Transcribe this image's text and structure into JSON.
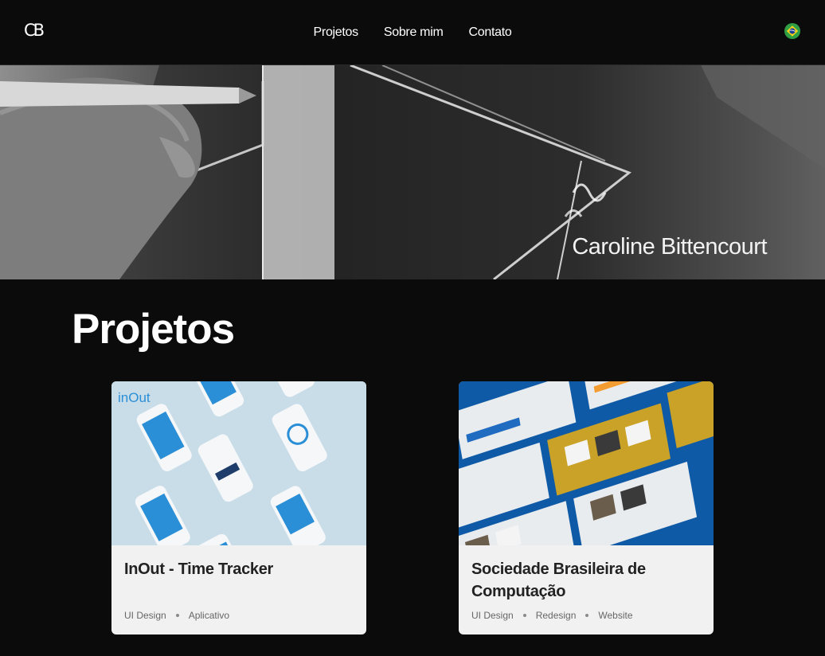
{
  "header": {
    "logo": "CB",
    "nav": [
      {
        "label": "Projetos"
      },
      {
        "label": "Sobre mim"
      },
      {
        "label": "Contato"
      }
    ],
    "language_icon": "brazil-flag-icon"
  },
  "hero": {
    "name": "Caroline Bittencourt"
  },
  "projects": {
    "title": "Projetos",
    "cards": [
      {
        "title": "InOut - Time Tracker",
        "image_logo": "inOut",
        "tags": [
          "UI Design",
          "Aplicativo"
        ]
      },
      {
        "title": "Sociedade Brasileira de Computação",
        "tags": [
          "UI Design",
          "Redesign",
          "Website"
        ]
      }
    ]
  },
  "colors": {
    "background": "#0b0b0b",
    "card": "#f1f1f1",
    "inout_blue": "#2a8fd6",
    "sbc_blue": "#1a5fa8",
    "sbc_gold": "#c9a227"
  }
}
